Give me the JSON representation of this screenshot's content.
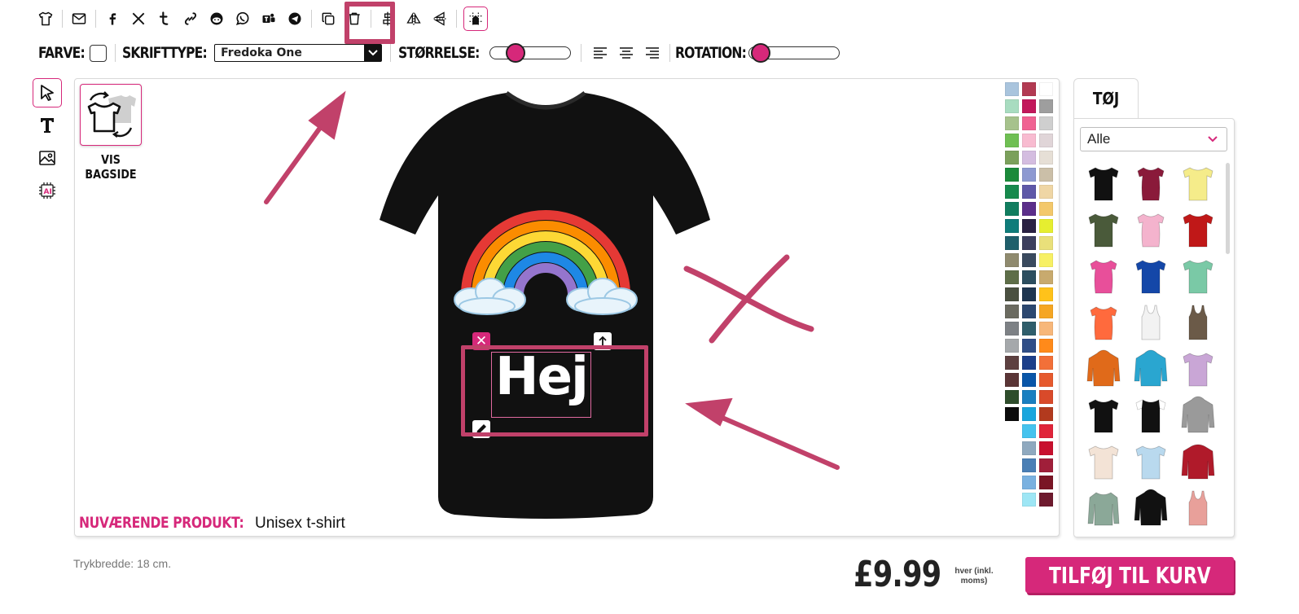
{
  "toolbar": {
    "icons": [
      "tshirt-icon",
      "mail-icon",
      "facebook-icon",
      "x-twitter-icon",
      "tumblr-icon",
      "link-icon",
      "reddit-icon",
      "whatsapp-icon",
      "teams-icon",
      "telegram-icon",
      "duplicate-icon",
      "trash-icon",
      "align-center-icon",
      "flip-horizontal-icon",
      "flip-vertical-icon",
      "grid-snap-icon"
    ]
  },
  "props": {
    "color_label": "FARVE:",
    "font_label": "SKRIFTTYPE:",
    "font_value": "Fredoka One",
    "size_label": "STØRRELSE:",
    "size_level": 0.25,
    "rotation_label": "ROTATION:",
    "rotation_level": 0.02
  },
  "left_tools": [
    "select-arrow-icon",
    "text-tool-icon",
    "image-tool-icon",
    "ai-tool-icon"
  ],
  "canvas": {
    "backside_label": "VIS BAGSIDE",
    "text_element": "Hej",
    "current_product_label": "NUVÆRENDE PRODUKT:",
    "current_product_value": "Unisex t-shirt",
    "shirt_color": "#111111"
  },
  "colors": [
    "#a9c4dd",
    "#b23a52",
    "#ffffff",
    "#a8dcc0",
    "#c2185b",
    "#9e9e9e",
    "#a6c28c",
    "#f06292",
    "#cfcfcf",
    "#6fbf53",
    "#f8bbd0",
    "#e0d5d8",
    "#7ba05b",
    "#d4bde0",
    "#e6dfd6",
    "#1b8a3a",
    "#8e99d1",
    "#cbbfa8",
    "#178a4d",
    "#5e58a8",
    "#efd6a5",
    "#117d5f",
    "#5b2e8a",
    "#f3c86b",
    "#0f7c7a",
    "#2b2143",
    "#e6ee30",
    "#1f5f6b",
    "#3d3f5e",
    "#e9e07a",
    "#8f8a6e",
    "#3a4a5e",
    "#f7f064",
    "#5e6e48",
    "#2c4e5f",
    "#c8aa6e",
    "#4a5040",
    "#1f3650",
    "#ffc21a",
    "#6b6b60",
    "#2c4870",
    "#f5a623",
    "#7d8185",
    "#2f5e6b",
    "#f7b77a",
    "#a5a8ab",
    "#304e87",
    "#ff8a1a",
    "#5d4040",
    "#1c3f8a",
    "#f27038",
    "#5a3536",
    "#0a56a8",
    "#e65a2e",
    "#2e4d2b",
    "#1a7fc0",
    "#d94a2a",
    "#0b0b0b",
    "#1aa6dd",
    "#b23a1e",
    "",
    "#45c3ee",
    "#e0243a",
    "",
    "#8fa9bf",
    "#c8102e",
    "",
    "#4a7fb5",
    "#a01f3a",
    "",
    "#7ab1e0",
    "#7a1525",
    "",
    "#9ee6f5",
    "#6e1a2e"
  ],
  "panel": {
    "tab_label": "TØJ",
    "filter_value": "Alle",
    "products": [
      {
        "kind": "tshirt",
        "color": "#111111"
      },
      {
        "kind": "tshirt-women",
        "color": "#8a1a3a"
      },
      {
        "kind": "tshirt",
        "color": "#f5ec8a"
      },
      {
        "kind": "tshirt",
        "color": "#4a5a3a"
      },
      {
        "kind": "tshirt-women",
        "color": "#f4b3cd"
      },
      {
        "kind": "tshirt",
        "color": "#c01818"
      },
      {
        "kind": "tshirt-women",
        "color": "#e84f9a"
      },
      {
        "kind": "tshirt",
        "color": "#1447a8"
      },
      {
        "kind": "tshirt",
        "color": "#7ac9a6"
      },
      {
        "kind": "tshirt-women",
        "color": "#ff6a3d"
      },
      {
        "kind": "tank",
        "color": "#f2f2f2"
      },
      {
        "kind": "tank",
        "color": "#6b5a48"
      },
      {
        "kind": "hoodie",
        "color": "#e06a1a"
      },
      {
        "kind": "hoodie",
        "color": "#2aa6d0"
      },
      {
        "kind": "tshirt",
        "color": "#c9a6d6"
      },
      {
        "kind": "tshirt",
        "color": "#111111"
      },
      {
        "kind": "raglan",
        "color": "#111111"
      },
      {
        "kind": "hoodie",
        "color": "#9a9a9a"
      },
      {
        "kind": "tshirt",
        "color": "#f3e3d6"
      },
      {
        "kind": "tshirt",
        "color": "#b9d9ee"
      },
      {
        "kind": "jacket",
        "color": "#b01a2a"
      },
      {
        "kind": "longsleeve",
        "color": "#8ba898"
      },
      {
        "kind": "hoodie",
        "color": "#111111"
      },
      {
        "kind": "tank",
        "color": "#e8a09a"
      }
    ]
  },
  "footer": {
    "print_width": "Trykbredde: 18 cm.",
    "price": "£9.99",
    "price_note": "hver (inkl. moms)",
    "cart_button": "TILFØJ TIL KURV"
  }
}
